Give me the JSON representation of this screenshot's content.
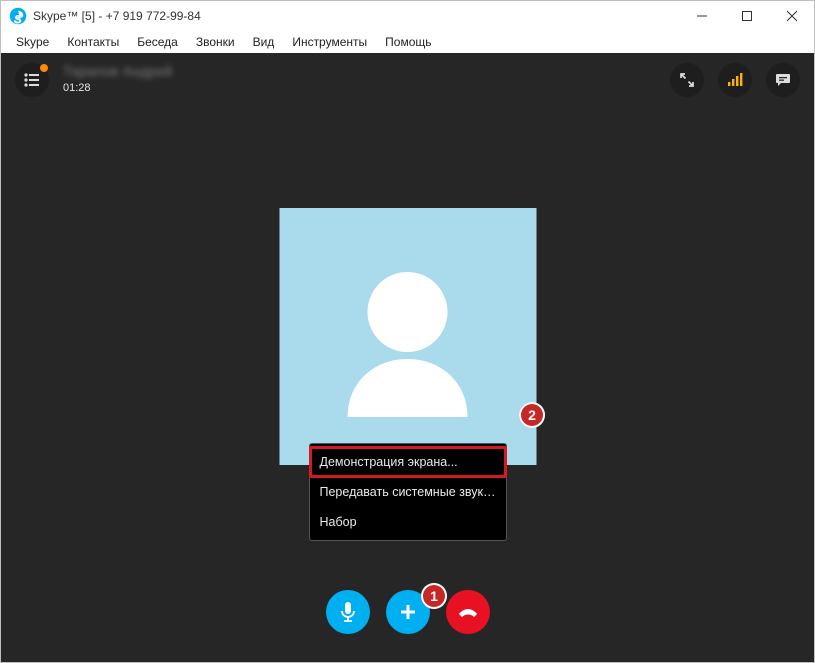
{
  "window": {
    "title": "Skype™ [5] - +7 919 772-99-84"
  },
  "menu": {
    "items": [
      "Skype",
      "Контакты",
      "Беседа",
      "Звонки",
      "Вид",
      "Инструменты",
      "Помощь"
    ]
  },
  "call": {
    "contact_name": "Тарапов Андрей",
    "timer": "01:28"
  },
  "popup": {
    "items": [
      "Демонстрация экрана...",
      "Передавать системные звуки...",
      "Набор"
    ]
  },
  "icons": {
    "mic": "mic-icon",
    "add": "plus-icon",
    "hangup": "hangup-icon",
    "fullscreen": "fullscreen-icon",
    "signal": "signal-icon",
    "chat": "chat-icon",
    "list": "list-icon"
  },
  "annotations": {
    "one": "1",
    "two": "2"
  }
}
